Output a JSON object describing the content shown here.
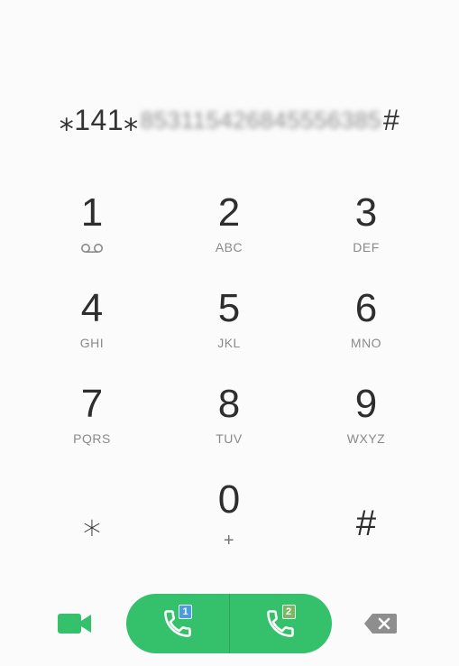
{
  "display": {
    "prefix": "⁎141⁎",
    "masked_number": "853115426845556385",
    "suffix": "#"
  },
  "keys": [
    {
      "digit": "1",
      "letters": "",
      "icon": "voicemail-icon"
    },
    {
      "digit": "2",
      "letters": "ABC"
    },
    {
      "digit": "3",
      "letters": "DEF"
    },
    {
      "digit": "4",
      "letters": "GHI"
    },
    {
      "digit": "5",
      "letters": "JKL"
    },
    {
      "digit": "6",
      "letters": "MNO"
    },
    {
      "digit": "7",
      "letters": "PQRS"
    },
    {
      "digit": "8",
      "letters": "TUV"
    },
    {
      "digit": "9",
      "letters": "WXYZ"
    },
    {
      "digit": "⁎",
      "letters": ""
    },
    {
      "digit": "0",
      "letters": "+"
    },
    {
      "digit": "#",
      "letters": ""
    }
  ],
  "bottom_bar": {
    "video_icon": "video-call-icon",
    "call_sim1_badge": "1",
    "call_sim2_badge": "2",
    "backspace_icon": "backspace-icon"
  },
  "colors": {
    "call_green": "#35c06b",
    "sim1_blue": "#4a9be0",
    "sim2_green": "#7bb866",
    "backspace_gray": "#8e8e8e"
  }
}
